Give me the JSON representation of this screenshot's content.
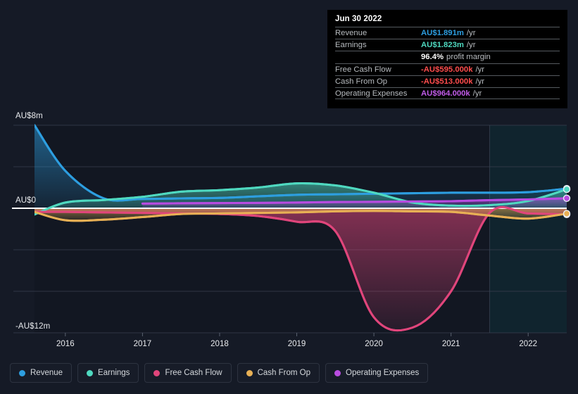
{
  "chart_data": {
    "type": "area",
    "title": "",
    "xlabel": "",
    "ylabel": "",
    "currency": "AU$",
    "ylim": [
      -12,
      8
    ],
    "y_ticks": [
      {
        "label": "AU$8m",
        "value": 8
      },
      {
        "label": "AU$0",
        "value": 0
      },
      {
        "label": "-AU$12m",
        "value": -12
      }
    ],
    "grid": true,
    "legend_position": "bottom",
    "x_ticks": [
      "2016",
      "2017",
      "2018",
      "2019",
      "2020",
      "2021",
      "2022"
    ],
    "x_range": [
      2015.6,
      2022.5
    ],
    "forecast_start": 2021.5,
    "x": [
      2015.6,
      2016.0,
      2016.5,
      2017.0,
      2017.5,
      2018.0,
      2018.5,
      2019.0,
      2019.5,
      2020.0,
      2020.5,
      2021.0,
      2021.5,
      2022.0,
      2022.5
    ],
    "series": [
      {
        "name": "Revenue",
        "color": "#2d9ee0",
        "values": [
          8.0,
          3.6,
          0.95,
          0.9,
          0.95,
          1.0,
          1.15,
          1.3,
          1.35,
          1.4,
          1.45,
          1.5,
          1.5,
          1.55,
          1.891
        ]
      },
      {
        "name": "Earnings",
        "color": "#4fd9c0",
        "values": [
          -0.6,
          0.55,
          0.8,
          1.1,
          1.6,
          1.75,
          2.0,
          2.4,
          2.2,
          1.5,
          0.55,
          0.25,
          0.3,
          0.7,
          1.823
        ]
      },
      {
        "name": "Free Cash Flow",
        "color": "#e0457b",
        "values": [
          -0.35,
          -0.35,
          -0.4,
          -0.45,
          -0.5,
          -0.55,
          -0.75,
          -1.3,
          -2.2,
          -10.5,
          -11.5,
          -8.0,
          -0.45,
          -0.5,
          -0.595
        ]
      },
      {
        "name": "Cash From Op",
        "color": "#e8b055",
        "values": [
          -0.35,
          -1.15,
          -1.1,
          -0.85,
          -0.55,
          -0.5,
          -0.45,
          -0.4,
          -0.3,
          -0.25,
          -0.3,
          -0.35,
          -0.7,
          -1.0,
          -0.513
        ]
      },
      {
        "name": "Operating Expenses",
        "color": "#b84ce0",
        "values": [
          null,
          null,
          null,
          0.45,
          0.48,
          0.5,
          0.52,
          0.55,
          0.6,
          0.62,
          0.65,
          0.68,
          0.78,
          0.85,
          0.964
        ]
      }
    ]
  },
  "tooltip": {
    "date": "Jun 30 2022",
    "rows": [
      {
        "key": "Revenue",
        "value": "AU$1.891m",
        "unit": "/yr",
        "color": "#2d9ee0"
      },
      {
        "key": "Earnings",
        "value": "AU$1.823m",
        "unit": "/yr",
        "color": "#4fd9c0"
      },
      {
        "key": "",
        "value": "96.4%",
        "unit": "profit margin",
        "color": "#ffffff",
        "is_sub": true
      },
      {
        "key": "Free Cash Flow",
        "value": "-AU$595.000k",
        "unit": "/yr",
        "color": "#ff4d4d"
      },
      {
        "key": "Cash From Op",
        "value": "-AU$513.000k",
        "unit": "/yr",
        "color": "#ff4d4d"
      },
      {
        "key": "Operating Expenses",
        "value": "AU$964.000k",
        "unit": "/yr",
        "color": "#c05ce8"
      }
    ]
  },
  "legend": {
    "items": [
      {
        "label": "Revenue",
        "color": "#2d9ee0"
      },
      {
        "label": "Earnings",
        "color": "#4fd9c0"
      },
      {
        "label": "Free Cash Flow",
        "color": "#e0457b"
      },
      {
        "label": "Cash From Op",
        "color": "#e8b055"
      },
      {
        "label": "Operating Expenses",
        "color": "#b84ce0"
      }
    ]
  },
  "axis": {
    "y_top": "AU$8m",
    "y_zero": "AU$0",
    "y_bottom": "-AU$12m"
  }
}
